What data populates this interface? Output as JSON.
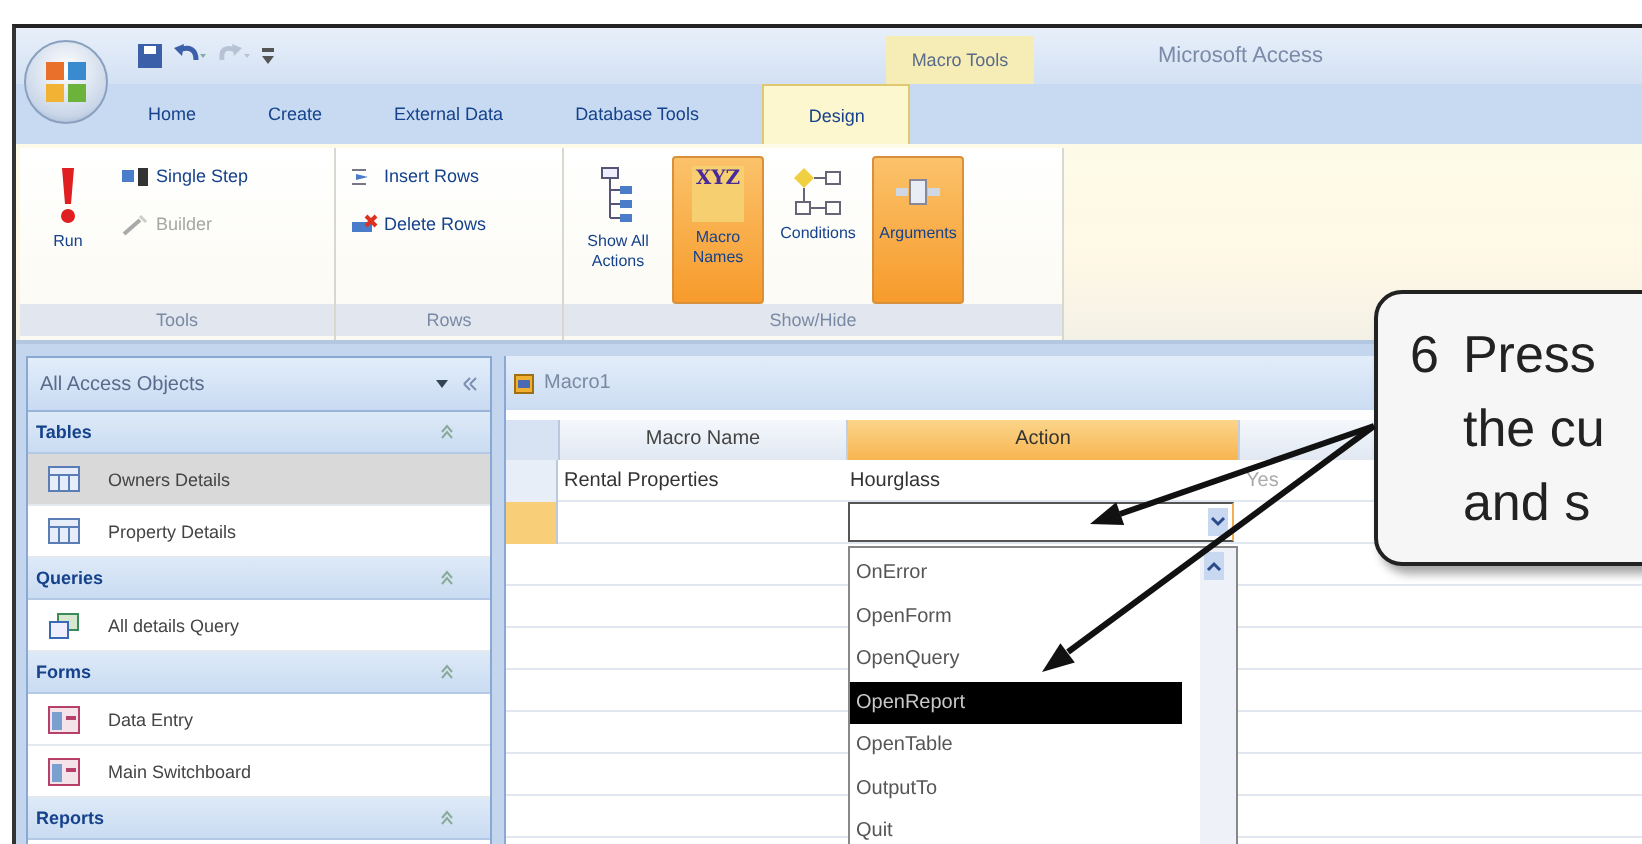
{
  "title_bar": {
    "context_tab": "Macro Tools",
    "title": "Microsoft Access"
  },
  "tabs": [
    {
      "label": "Home",
      "selected": false
    },
    {
      "label": "Create",
      "selected": false
    },
    {
      "label": "External Data",
      "selected": false
    },
    {
      "label": "Database Tools",
      "selected": false
    },
    {
      "label": "Design",
      "selected": true
    }
  ],
  "ribbon": [
    {
      "label": "Tools",
      "buttons": [
        {
          "label": "Run",
          "kind": "large",
          "selected": false
        },
        {
          "label": "Single Step",
          "kind": "small",
          "disabled": false
        },
        {
          "label": "Builder",
          "kind": "small",
          "disabled": true
        }
      ]
    },
    {
      "label": "Rows",
      "buttons": [
        {
          "label": "Insert Rows",
          "kind": "small",
          "disabled": false
        },
        {
          "label": "Delete Rows",
          "kind": "small",
          "disabled": false
        }
      ]
    },
    {
      "label": "Show/Hide",
      "buttons": [
        {
          "label": "Show All Actions",
          "kind": "large",
          "selected": false
        },
        {
          "label": "Macro Names",
          "kind": "large",
          "selected": true,
          "icon_text": "XYZ"
        },
        {
          "label": "Conditions",
          "kind": "large",
          "selected": false
        },
        {
          "label": "Arguments",
          "kind": "large",
          "selected": true
        }
      ]
    }
  ],
  "nav_pane": {
    "title": "All Access Objects",
    "sections": [
      {
        "label": "Tables",
        "kind": "table",
        "items": [
          {
            "label": "Owners Details",
            "selected": true
          },
          {
            "label": "Property Details",
            "selected": false
          }
        ]
      },
      {
        "label": "Queries",
        "kind": "query",
        "items": [
          {
            "label": "All details Query",
            "selected": false
          }
        ]
      },
      {
        "label": "Forms",
        "kind": "form",
        "items": [
          {
            "label": "Data Entry",
            "selected": false
          },
          {
            "label": "Main Switchboard",
            "selected": false
          }
        ]
      },
      {
        "label": "Reports"
      }
    ]
  },
  "document": {
    "tab": "Macro1",
    "columns": [
      {
        "label": "Macro Name",
        "selected": false
      },
      {
        "label": "Action",
        "selected": true
      }
    ],
    "rows": [
      {
        "cells": [
          "Rental Properties",
          "Hourglass",
          "Yes"
        ],
        "selected": false
      },
      {
        "selected": true
      }
    ],
    "dropdown_options": [
      {
        "label": "OnError",
        "selected": false
      },
      {
        "label": "OpenForm",
        "selected": false
      },
      {
        "label": "OpenQuery",
        "selected": false
      },
      {
        "label": "OpenReport",
        "selected": true
      },
      {
        "label": "OpenTable",
        "selected": false
      },
      {
        "label": "OutputTo",
        "selected": false
      },
      {
        "label": "Quit",
        "selected": false
      }
    ]
  },
  "callout": {
    "number": "6",
    "lines": [
      "Press",
      "the cu",
      "and s"
    ]
  }
}
